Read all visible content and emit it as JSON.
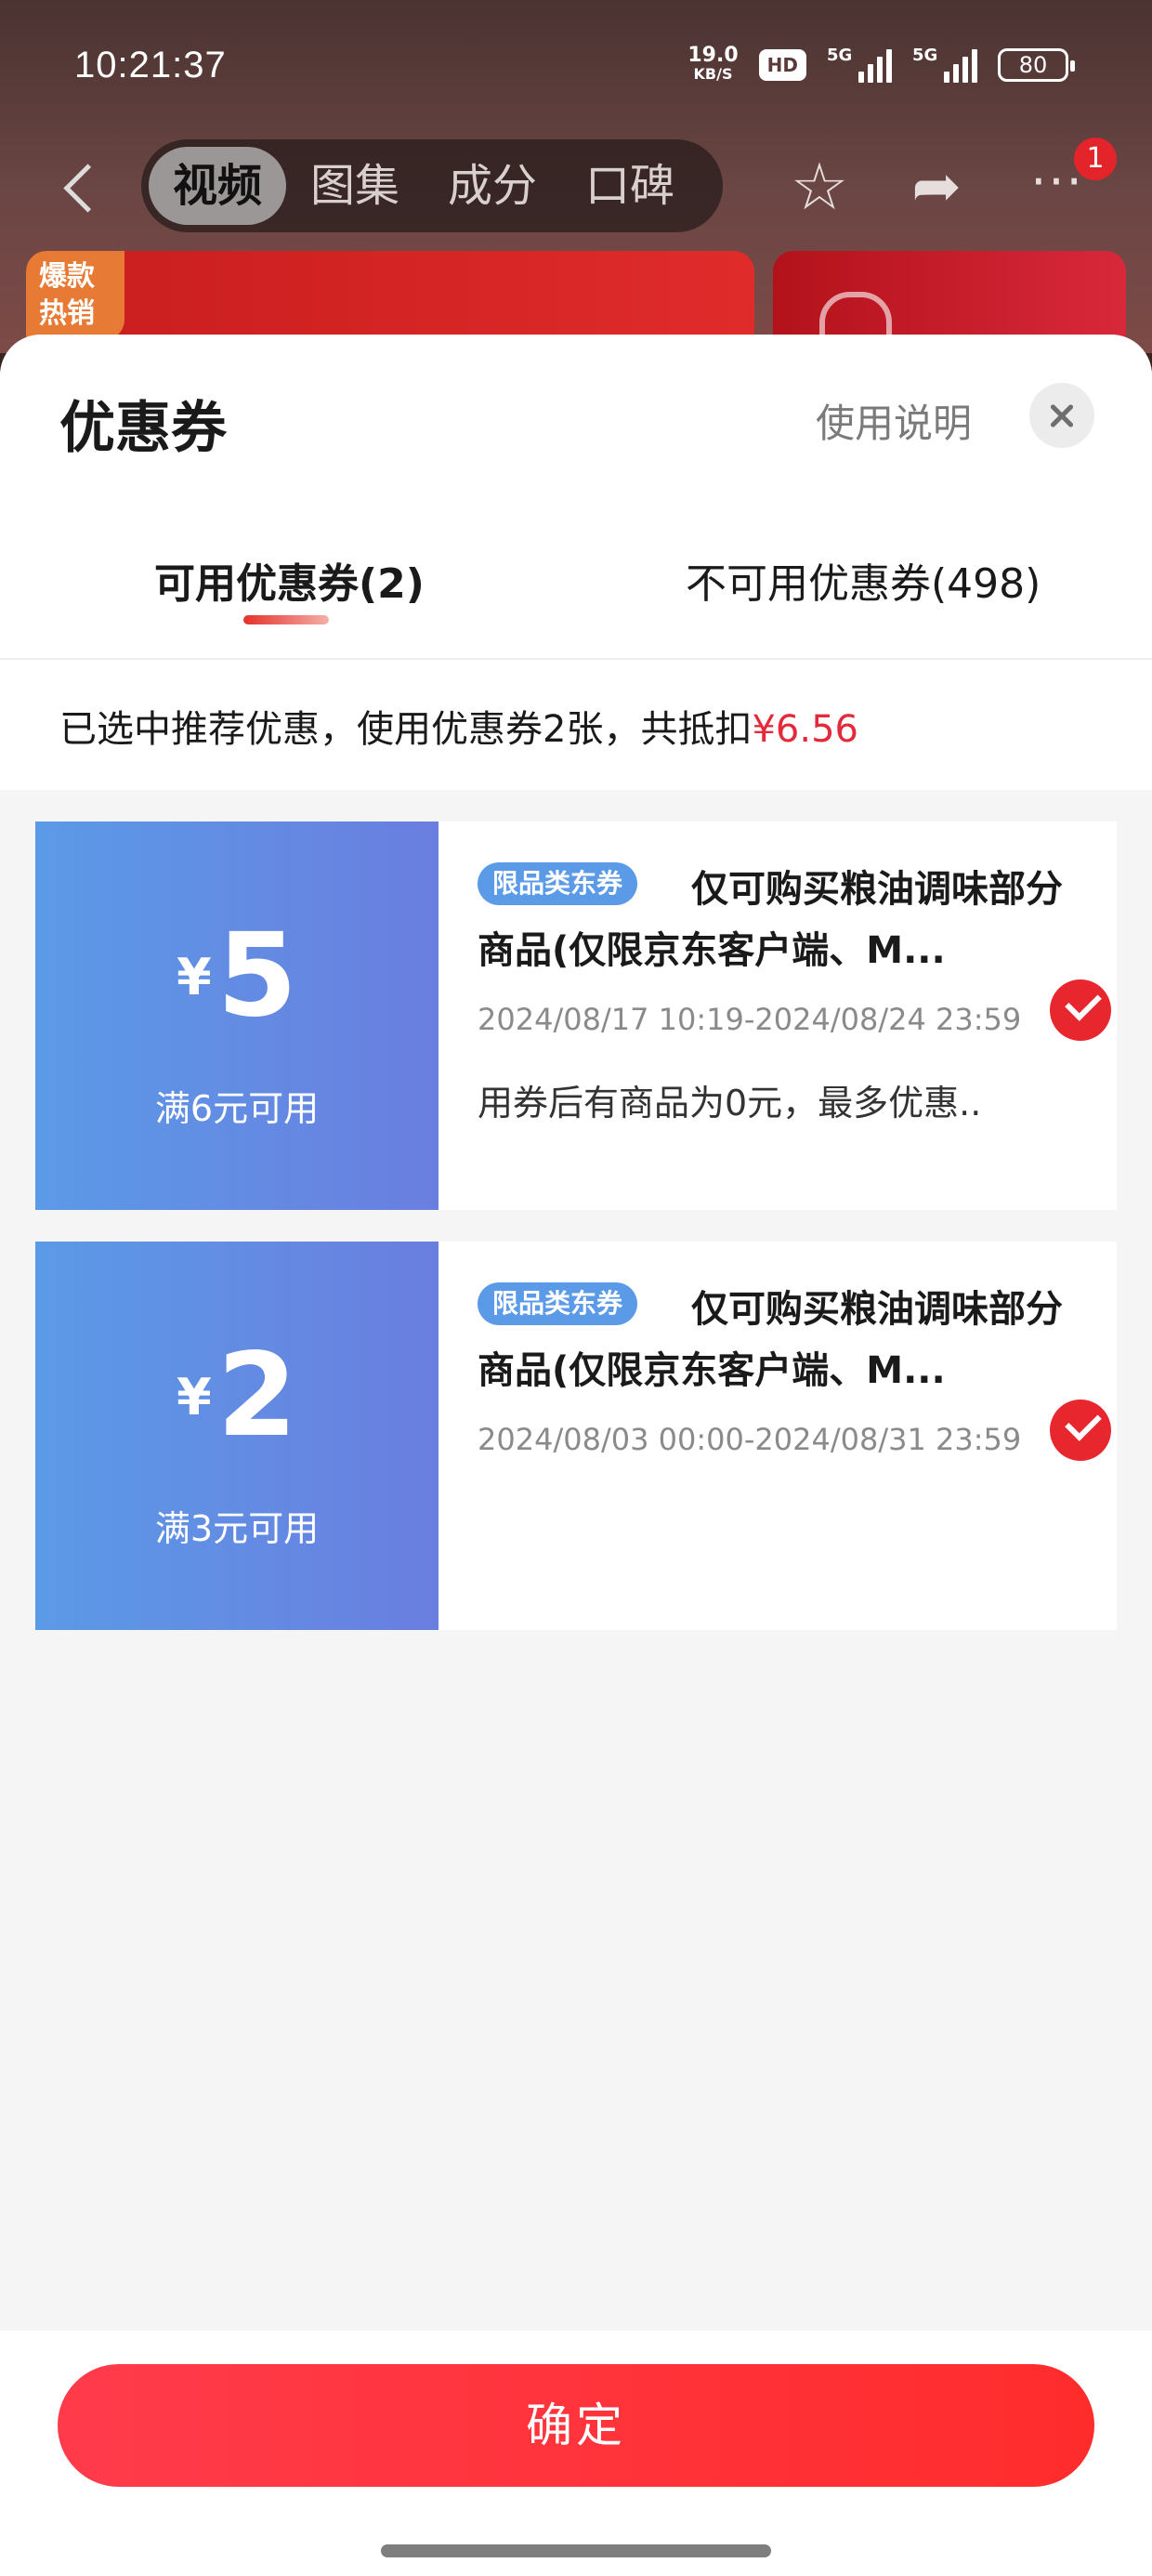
{
  "status_bar": {
    "time": "10:21:37",
    "net_speed": "19.0",
    "net_speed_unit": "KB/S",
    "hd": "HD",
    "signal1": "5G",
    "signal2": "5G",
    "battery": "80"
  },
  "nav": {
    "tabs": [
      {
        "label": "视频"
      },
      {
        "label": "图集"
      },
      {
        "label": "成分"
      },
      {
        "label": "口碑"
      }
    ],
    "more_badge": "1",
    "hot_tag": "爆款热销"
  },
  "sheet": {
    "title": "优惠券",
    "usage_link": "使用说明",
    "tabs": {
      "available": "可用优惠券(2)",
      "unavailable": "不可用优惠券(498)"
    },
    "summary_text": "已选中推荐优惠，使用优惠券2张，共抵扣",
    "summary_amount": "¥6.56"
  },
  "coupons": [
    {
      "currency": "¥",
      "value": "5",
      "condition": "满6元可用",
      "tag": "限品类东券",
      "name": "仅可购买粮油调味部分商品(仅限京东客户端、M...",
      "date": "2024/08/17 10:19-2024/08/24 23:59",
      "note": "用券后有商品为0元，最多优惠..",
      "checked": true
    },
    {
      "currency": "¥",
      "value": "2",
      "condition": "满3元可用",
      "tag": "限品类东券",
      "name": "仅可购买粮油调味部分商品(仅限京东客户端、M...",
      "date": "2024/08/03 00:00-2024/08/31 23:59",
      "note": "",
      "checked": true
    }
  ],
  "confirm_label": "确定",
  "colors": {
    "accent_red": "#e4293b",
    "coupon_blue": "#5b9ae6"
  }
}
